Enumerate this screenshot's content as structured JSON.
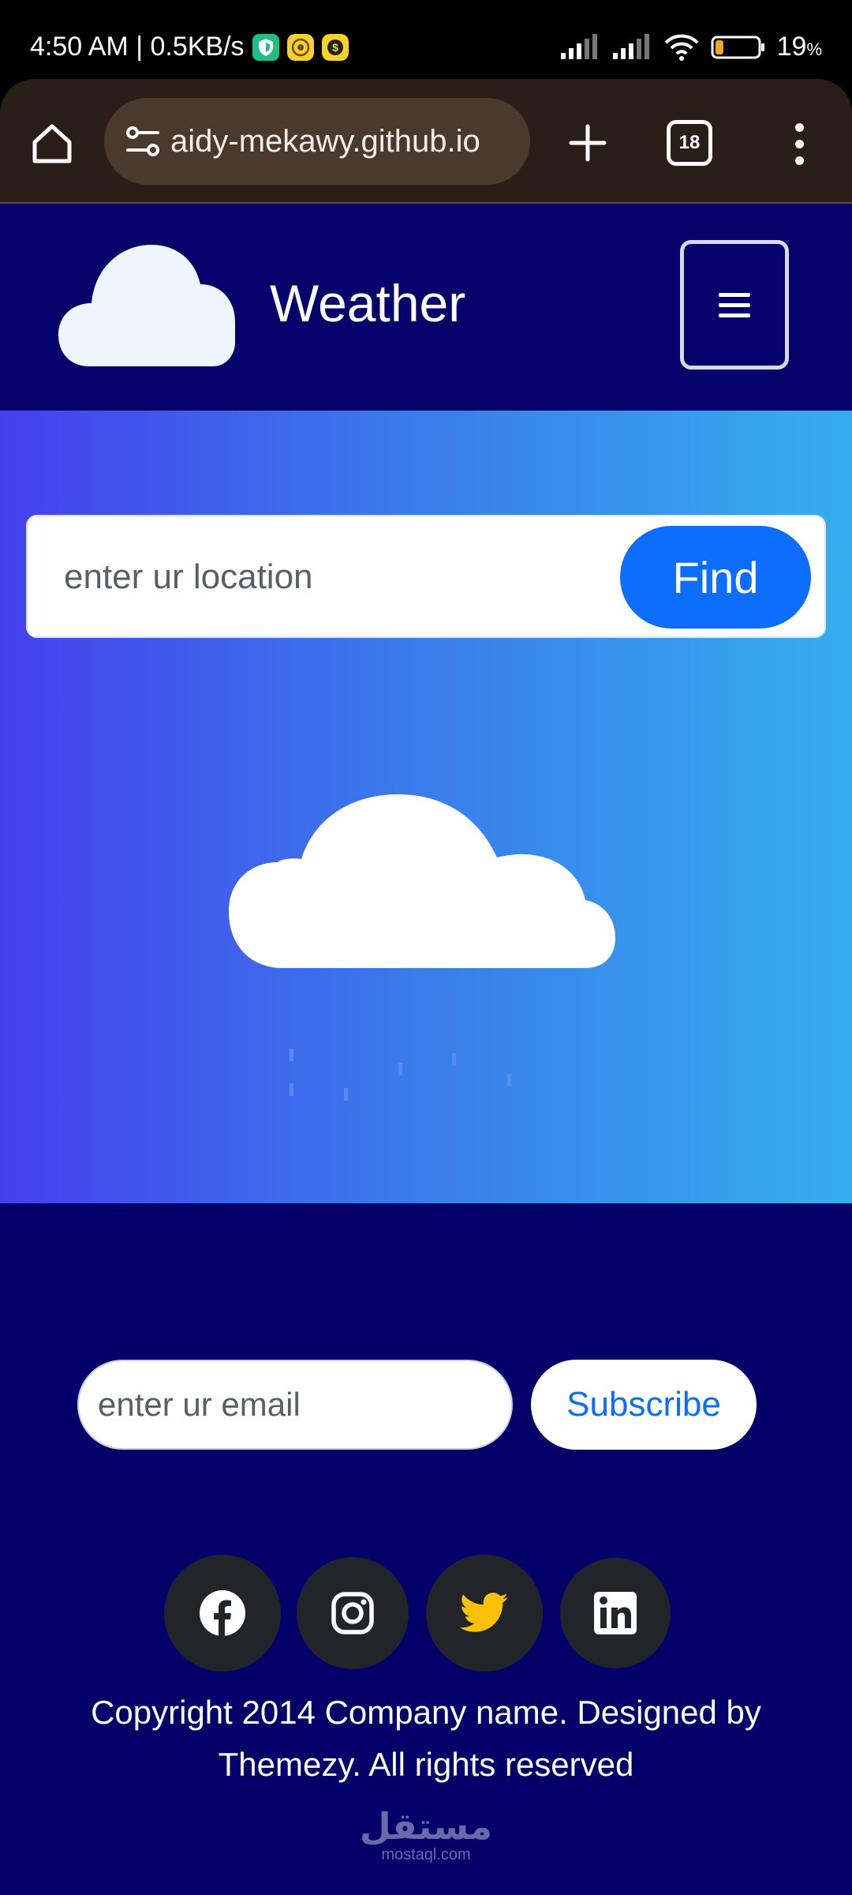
{
  "status_bar": {
    "time_speed": "4:50 AM | 0.5KB/s",
    "battery": "19",
    "battery_unit": "%",
    "battery_level_percent": 19,
    "icons": [
      "vpn-shield-icon",
      "coin-app-icon",
      "dollar-app-icon",
      "signal-icon",
      "signal-icon",
      "wifi-icon",
      "battery-icon"
    ]
  },
  "browser": {
    "url": "aidy-mekawy.github.io",
    "tab_count": "18",
    "icons": [
      "home-icon",
      "site-settings-icon",
      "new-tab-plus-icon",
      "tab-switcher-icon",
      "more-vert-icon"
    ]
  },
  "header": {
    "title": "Weather",
    "icons": [
      "cloud-logo-icon",
      "hamburger-menu-icon"
    ]
  },
  "search": {
    "placeholder": "enter ur location",
    "button_label": "Find"
  },
  "weather": {
    "icons": [
      "cloud-icon",
      "rain-drops-icon"
    ]
  },
  "footer": {
    "email_placeholder": "enter ur email",
    "subscribe_label": "Subscribe",
    "social": [
      {
        "name": "facebook-icon",
        "color": "#ffffff"
      },
      {
        "name": "instagram-icon",
        "color": "#ffffff"
      },
      {
        "name": "twitter-icon",
        "color": "#ffc107"
      },
      {
        "name": "linkedin-icon",
        "color": "#ffffff"
      }
    ],
    "copyright": "Copyright 2014 Company name. Designed by Themezy. All rights reserved"
  },
  "watermark": {
    "arabic": "مستقل",
    "latin": "mostaql.com"
  },
  "colors": {
    "header_bg": "#05026b",
    "footer_bg": "#03006a",
    "hero_gradient_start": "#4440ee",
    "hero_gradient_end": "#35aeee",
    "primary_button": "#0d6efd",
    "browser_bar": "#2a1f18"
  }
}
